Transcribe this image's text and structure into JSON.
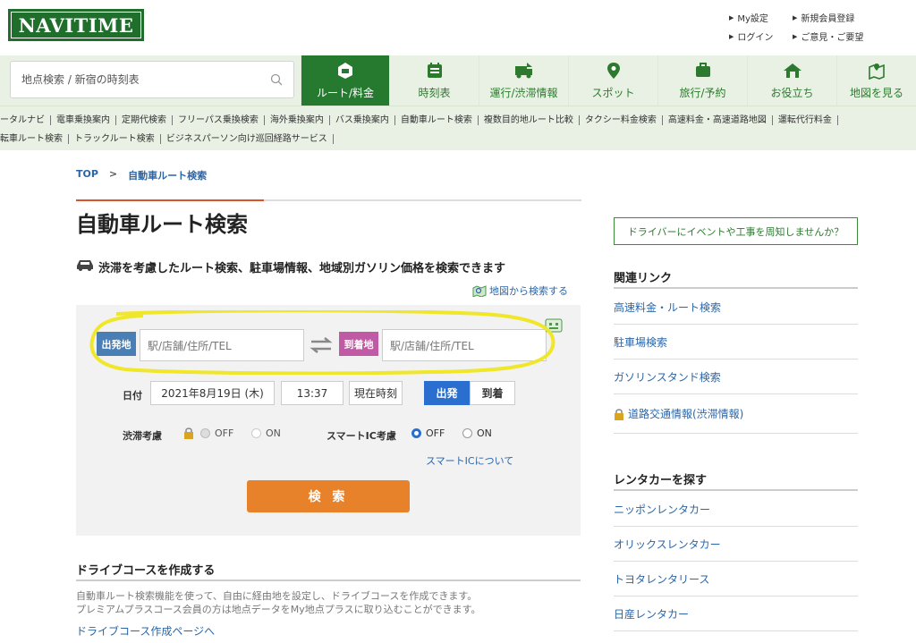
{
  "header": {
    "logo": "NAVITIME",
    "links": [
      "My設定",
      "新規会員登録",
      "ログイン",
      "ご意見・ご要望"
    ]
  },
  "search": {
    "placeholder": "地点検索 / 新宿の時刻表"
  },
  "nav": [
    {
      "label": "ルート/料金",
      "icon": "car-route-icon",
      "active": true
    },
    {
      "label": "時刻表",
      "icon": "timetable-icon"
    },
    {
      "label": "運行/渋滞情報",
      "icon": "traffic-icon"
    },
    {
      "label": "スポット",
      "icon": "pin-icon"
    },
    {
      "label": "旅行/予約",
      "icon": "suitcase-icon"
    },
    {
      "label": "お役立ち",
      "icon": "house-icon"
    },
    {
      "label": "地図を見る",
      "icon": "map-icon"
    }
  ],
  "subnav": {
    "row1": [
      "ータルナビ",
      "電車乗換案内",
      "定期代検索",
      "フリーパス乗換検索",
      "海外乗換案内",
      "バス乗換案内",
      "自動車ルート検索",
      "複数目的地ルート比較",
      "タクシー料金検索",
      "高速料金・高速道路地図",
      "運転代行料金"
    ],
    "row2": [
      "転車ルート検索",
      "トラックルート検索",
      "ビジネスパーソン向け巡回経路サービス"
    ]
  },
  "breadcrumb": {
    "home": "TOP",
    "sep": ">",
    "current": "自動車ルート検索"
  },
  "page": {
    "title": "自動車ルート検索",
    "subtitle": "渋滞を考慮したルート検索、駐車場情報、地域別ガソリン価格を検索できます",
    "map_search": "地図から検索する"
  },
  "form": {
    "from_tag": "出発地",
    "from_placeholder": "駅/店舗/住所/TEL",
    "to_tag": "到着地",
    "to_placeholder": "駅/店舗/住所/TEL",
    "date_label": "日付",
    "date": "2021年8月19日 (木)",
    "time": "13:37",
    "now_button": "現在時刻",
    "depart": "出発",
    "arrive": "到着",
    "traffic_label": "渋滞考慮",
    "off": "OFF",
    "on": "ON",
    "smartic_label": "スマートIC考慮",
    "smartic_link": "スマートICについて",
    "search_button": "検 索"
  },
  "drive": {
    "heading": "ドライブコースを作成する",
    "desc1": "自動車ルート検索機能を使って、自由に経由地を設定し、ドライブコースを作成できます。",
    "desc2": "プレミアムプラスコース会員の方は地点データをMy地点プラスに取り込むことができます。",
    "link": "ドライブコース作成ページへ"
  },
  "sidebar": {
    "banner": "ドライバーにイベントや工事を周知しませんか？",
    "related_heading": "関連リンク",
    "related": [
      "高速料金・ルート検索",
      "駐車場検索",
      "ガソリンスタンド検索",
      "道路交通情報(渋滞情報)"
    ],
    "rental_heading": "レンタカーを探す",
    "rental": [
      "ニッポンレンタカー",
      "オリックスレンタカー",
      "トヨタレンタリース",
      "日産レンタカー"
    ]
  },
  "colors": {
    "brand": "#1f6e2c",
    "nav_bg": "#e9f1e4",
    "accent_orange": "#e8822a",
    "from_tag": "#4a7fb5",
    "to_tag": "#c05aa5",
    "highlight": "#f0e62a"
  }
}
